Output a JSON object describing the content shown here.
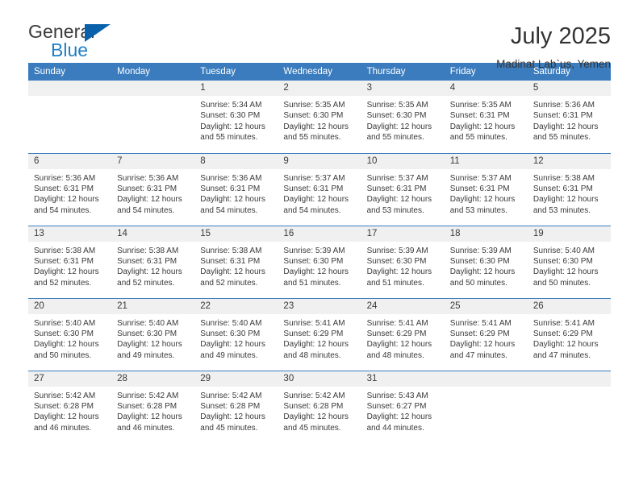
{
  "brand": {
    "name_top": "General",
    "name_bottom": "Blue"
  },
  "header": {
    "title": "July 2025",
    "subtitle": "Madinat Lab`us, Yemen"
  },
  "colors": {
    "header_blue": "#3a7cbe",
    "brand_blue": "#1f7fc4",
    "daynum_band": "#f0f0f0",
    "text": "#3a3a3a"
  },
  "weekday_headers": [
    "Sunday",
    "Monday",
    "Tuesday",
    "Wednesday",
    "Thursday",
    "Friday",
    "Saturday"
  ],
  "labels": {
    "sunrise_prefix": "Sunrise:",
    "sunset_prefix": "Sunset:",
    "daylight_prefix": "Daylight:"
  },
  "weeks": [
    [
      {
        "day": "",
        "sunrise": "",
        "sunset": "",
        "daylight": "",
        "empty": true
      },
      {
        "day": "",
        "sunrise": "",
        "sunset": "",
        "daylight": "",
        "empty": true
      },
      {
        "day": "1",
        "sunrise": "Sunrise: 5:34 AM",
        "sunset": "Sunset: 6:30 PM",
        "daylight": "Daylight: 12 hours and 55 minutes."
      },
      {
        "day": "2",
        "sunrise": "Sunrise: 5:35 AM",
        "sunset": "Sunset: 6:30 PM",
        "daylight": "Daylight: 12 hours and 55 minutes."
      },
      {
        "day": "3",
        "sunrise": "Sunrise: 5:35 AM",
        "sunset": "Sunset: 6:30 PM",
        "daylight": "Daylight: 12 hours and 55 minutes."
      },
      {
        "day": "4",
        "sunrise": "Sunrise: 5:35 AM",
        "sunset": "Sunset: 6:31 PM",
        "daylight": "Daylight: 12 hours and 55 minutes."
      },
      {
        "day": "5",
        "sunrise": "Sunrise: 5:36 AM",
        "sunset": "Sunset: 6:31 PM",
        "daylight": "Daylight: 12 hours and 55 minutes."
      }
    ],
    [
      {
        "day": "6",
        "sunrise": "Sunrise: 5:36 AM",
        "sunset": "Sunset: 6:31 PM",
        "daylight": "Daylight: 12 hours and 54 minutes."
      },
      {
        "day": "7",
        "sunrise": "Sunrise: 5:36 AM",
        "sunset": "Sunset: 6:31 PM",
        "daylight": "Daylight: 12 hours and 54 minutes."
      },
      {
        "day": "8",
        "sunrise": "Sunrise: 5:36 AM",
        "sunset": "Sunset: 6:31 PM",
        "daylight": "Daylight: 12 hours and 54 minutes."
      },
      {
        "day": "9",
        "sunrise": "Sunrise: 5:37 AM",
        "sunset": "Sunset: 6:31 PM",
        "daylight": "Daylight: 12 hours and 54 minutes."
      },
      {
        "day": "10",
        "sunrise": "Sunrise: 5:37 AM",
        "sunset": "Sunset: 6:31 PM",
        "daylight": "Daylight: 12 hours and 53 minutes."
      },
      {
        "day": "11",
        "sunrise": "Sunrise: 5:37 AM",
        "sunset": "Sunset: 6:31 PM",
        "daylight": "Daylight: 12 hours and 53 minutes."
      },
      {
        "day": "12",
        "sunrise": "Sunrise: 5:38 AM",
        "sunset": "Sunset: 6:31 PM",
        "daylight": "Daylight: 12 hours and 53 minutes."
      }
    ],
    [
      {
        "day": "13",
        "sunrise": "Sunrise: 5:38 AM",
        "sunset": "Sunset: 6:31 PM",
        "daylight": "Daylight: 12 hours and 52 minutes."
      },
      {
        "day": "14",
        "sunrise": "Sunrise: 5:38 AM",
        "sunset": "Sunset: 6:31 PM",
        "daylight": "Daylight: 12 hours and 52 minutes."
      },
      {
        "day": "15",
        "sunrise": "Sunrise: 5:38 AM",
        "sunset": "Sunset: 6:31 PM",
        "daylight": "Daylight: 12 hours and 52 minutes."
      },
      {
        "day": "16",
        "sunrise": "Sunrise: 5:39 AM",
        "sunset": "Sunset: 6:30 PM",
        "daylight": "Daylight: 12 hours and 51 minutes."
      },
      {
        "day": "17",
        "sunrise": "Sunrise: 5:39 AM",
        "sunset": "Sunset: 6:30 PM",
        "daylight": "Daylight: 12 hours and 51 minutes."
      },
      {
        "day": "18",
        "sunrise": "Sunrise: 5:39 AM",
        "sunset": "Sunset: 6:30 PM",
        "daylight": "Daylight: 12 hours and 50 minutes."
      },
      {
        "day": "19",
        "sunrise": "Sunrise: 5:40 AM",
        "sunset": "Sunset: 6:30 PM",
        "daylight": "Daylight: 12 hours and 50 minutes."
      }
    ],
    [
      {
        "day": "20",
        "sunrise": "Sunrise: 5:40 AM",
        "sunset": "Sunset: 6:30 PM",
        "daylight": "Daylight: 12 hours and 50 minutes."
      },
      {
        "day": "21",
        "sunrise": "Sunrise: 5:40 AM",
        "sunset": "Sunset: 6:30 PM",
        "daylight": "Daylight: 12 hours and 49 minutes."
      },
      {
        "day": "22",
        "sunrise": "Sunrise: 5:40 AM",
        "sunset": "Sunset: 6:30 PM",
        "daylight": "Daylight: 12 hours and 49 minutes."
      },
      {
        "day": "23",
        "sunrise": "Sunrise: 5:41 AM",
        "sunset": "Sunset: 6:29 PM",
        "daylight": "Daylight: 12 hours and 48 minutes."
      },
      {
        "day": "24",
        "sunrise": "Sunrise: 5:41 AM",
        "sunset": "Sunset: 6:29 PM",
        "daylight": "Daylight: 12 hours and 48 minutes."
      },
      {
        "day": "25",
        "sunrise": "Sunrise: 5:41 AM",
        "sunset": "Sunset: 6:29 PM",
        "daylight": "Daylight: 12 hours and 47 minutes."
      },
      {
        "day": "26",
        "sunrise": "Sunrise: 5:41 AM",
        "sunset": "Sunset: 6:29 PM",
        "daylight": "Daylight: 12 hours and 47 minutes."
      }
    ],
    [
      {
        "day": "27",
        "sunrise": "Sunrise: 5:42 AM",
        "sunset": "Sunset: 6:28 PM",
        "daylight": "Daylight: 12 hours and 46 minutes."
      },
      {
        "day": "28",
        "sunrise": "Sunrise: 5:42 AM",
        "sunset": "Sunset: 6:28 PM",
        "daylight": "Daylight: 12 hours and 46 minutes."
      },
      {
        "day": "29",
        "sunrise": "Sunrise: 5:42 AM",
        "sunset": "Sunset: 6:28 PM",
        "daylight": "Daylight: 12 hours and 45 minutes."
      },
      {
        "day": "30",
        "sunrise": "Sunrise: 5:42 AM",
        "sunset": "Sunset: 6:28 PM",
        "daylight": "Daylight: 12 hours and 45 minutes."
      },
      {
        "day": "31",
        "sunrise": "Sunrise: 5:43 AM",
        "sunset": "Sunset: 6:27 PM",
        "daylight": "Daylight: 12 hours and 44 minutes."
      },
      {
        "day": "",
        "sunrise": "",
        "sunset": "",
        "daylight": "",
        "empty": true
      },
      {
        "day": "",
        "sunrise": "",
        "sunset": "",
        "daylight": "",
        "empty": true
      }
    ]
  ]
}
